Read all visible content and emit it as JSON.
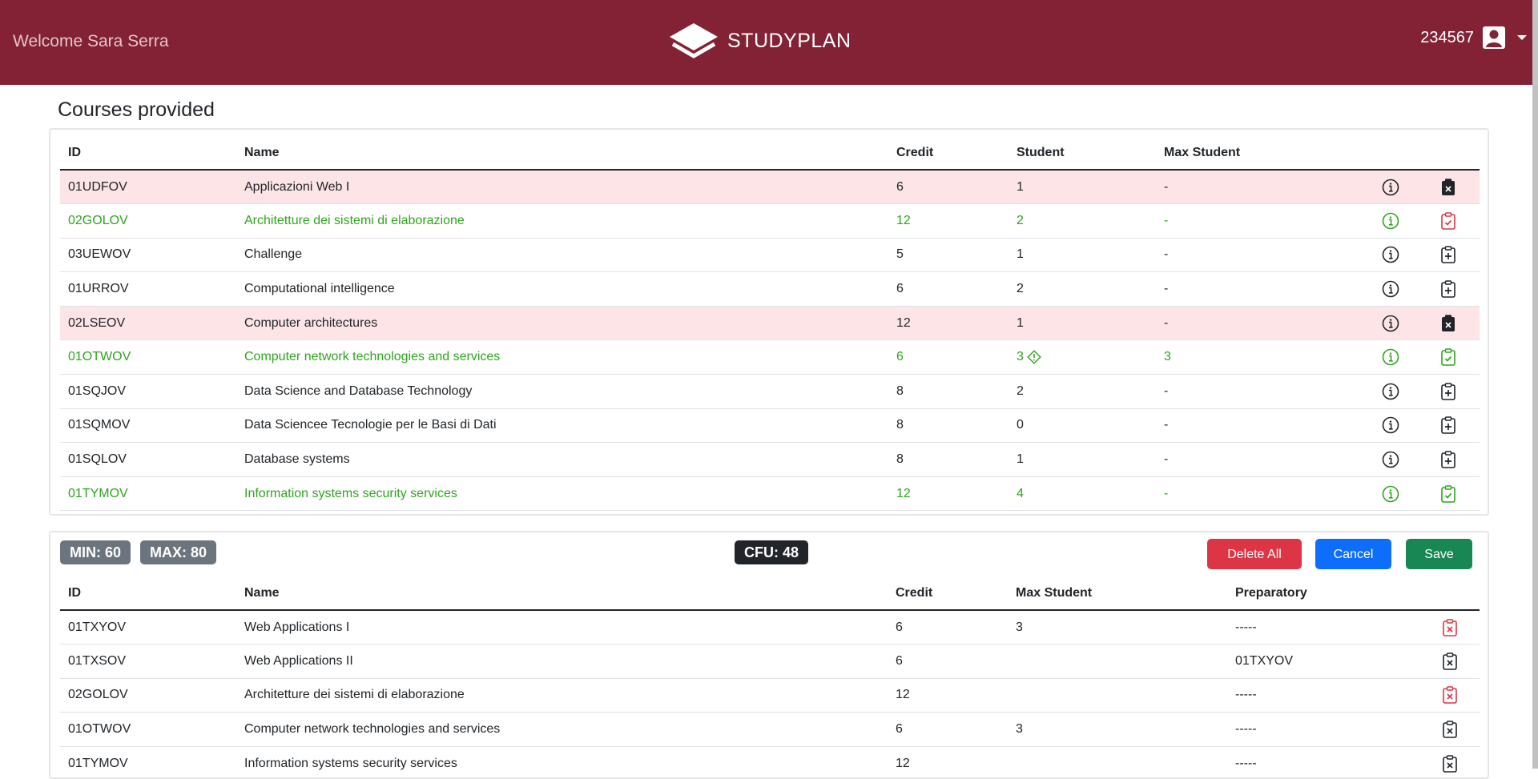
{
  "header": {
    "welcome": "Welcome Sara Serra",
    "brand": "STUDYPLAN",
    "user_id": "234567"
  },
  "courses": {
    "title": "Courses provided",
    "columns": {
      "id": "ID",
      "name": "Name",
      "credit": "Credit",
      "student": "Student",
      "max": "Max Student"
    },
    "rows": [
      {
        "id": "01UDFOV",
        "name": "Applicazioni Web I",
        "credit": "6",
        "student": "1",
        "max": "-",
        "state": "red",
        "action": "remove-filled"
      },
      {
        "id": "02GOLOV",
        "name": "Architetture dei sistemi di elaborazione",
        "credit": "12",
        "student": "2",
        "max": "-",
        "state": "green",
        "action": "check-red"
      },
      {
        "id": "03UEWOV",
        "name": "Challenge",
        "credit": "5",
        "student": "1",
        "max": "-",
        "state": "normal",
        "action": "add"
      },
      {
        "id": "01URROV",
        "name": "Computational intelligence",
        "credit": "6",
        "student": "2",
        "max": "-",
        "state": "normal",
        "action": "add"
      },
      {
        "id": "02LSEOV",
        "name": "Computer architectures",
        "credit": "12",
        "student": "1",
        "max": "-",
        "state": "red",
        "action": "remove-filled"
      },
      {
        "id": "01OTWOV",
        "name": "Computer network technologies and services",
        "credit": "6",
        "student": "3",
        "max": "3",
        "state": "green",
        "action": "check-green",
        "warning": true
      },
      {
        "id": "01SQJOV",
        "name": "Data Science and Database Technology",
        "credit": "8",
        "student": "2",
        "max": "-",
        "state": "normal",
        "action": "add"
      },
      {
        "id": "01SQMOV",
        "name": "Data Sciencee Tecnologie per le Basi di Dati",
        "credit": "8",
        "student": "0",
        "max": "-",
        "state": "normal",
        "action": "add"
      },
      {
        "id": "01SQLOV",
        "name": "Database systems",
        "credit": "8",
        "student": "1",
        "max": "-",
        "state": "normal",
        "action": "add"
      },
      {
        "id": "01TYMOV",
        "name": "Information systems security services",
        "credit": "12",
        "student": "4",
        "max": "-",
        "state": "green",
        "action": "check-green"
      }
    ]
  },
  "plan": {
    "min_label": "MIN: 60",
    "max_label": "MAX: 80",
    "cfu_label": "CFU: 48",
    "delete_all": "Delete All",
    "cancel": "Cancel",
    "save": "Save",
    "columns": {
      "id": "ID",
      "name": "Name",
      "credit": "Credit",
      "max": "Max Student",
      "prep": "Preparatory"
    },
    "rows": [
      {
        "id": "01TXYOV",
        "name": "Web Applications I",
        "credit": "6",
        "max": "3",
        "prep": "-----",
        "action": "remove-red"
      },
      {
        "id": "01TXSOV",
        "name": "Web Applications II",
        "credit": "6",
        "max": "",
        "prep": "01TXYOV",
        "action": "remove"
      },
      {
        "id": "02GOLOV",
        "name": "Architetture dei sistemi di elaborazione",
        "credit": "12",
        "max": "",
        "prep": "-----",
        "action": "remove-red"
      },
      {
        "id": "01OTWOV",
        "name": "Computer network technologies and services",
        "credit": "6",
        "max": "3",
        "prep": "-----",
        "action": "remove"
      },
      {
        "id": "01TYMOV",
        "name": "Information systems security services",
        "credit": "12",
        "max": "",
        "prep": "-----",
        "action": "remove"
      }
    ]
  },
  "colors": {
    "navbar": "#832235",
    "green": "#2ea51d",
    "red": "#dc3545",
    "highlight_red": "#fde4e6"
  }
}
